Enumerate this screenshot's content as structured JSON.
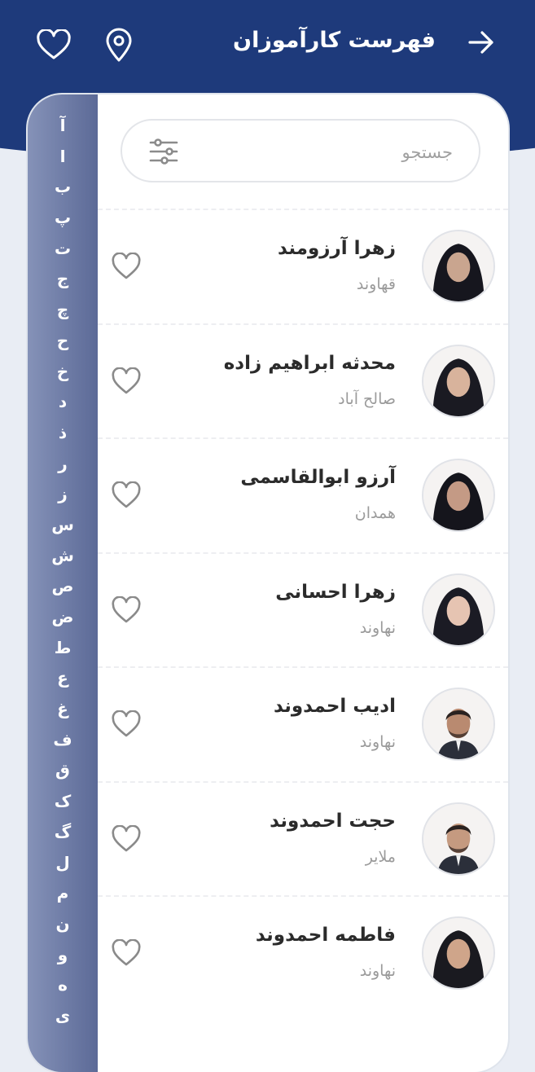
{
  "header": {
    "title": "فهرست کارآموزان",
    "back_icon": "arrow-right-icon",
    "location_icon": "map-pin-icon",
    "favorites_icon": "heart-outline-icon",
    "color": "#1e3a7b"
  },
  "search": {
    "placeholder": "جستجو",
    "filter_icon": "sliders-icon"
  },
  "alphabet": [
    "آ",
    "ا",
    "ب",
    "پ",
    "ت",
    "ج",
    "چ",
    "ح",
    "خ",
    "د",
    "ذ",
    "ر",
    "ز",
    "س",
    "ش",
    "ص",
    "ض",
    "ط",
    "ع",
    "غ",
    "ف",
    "ق",
    "ک",
    "گ",
    "ل",
    "م",
    "ن",
    "و",
    "ه",
    "ی"
  ],
  "trainees": [
    {
      "name": "زهرا آرزومند",
      "city": "قهاوند"
    },
    {
      "name": "محدثه ابراهیم زاده",
      "city": "صالح آباد"
    },
    {
      "name": "آرزو ابوالقاسمی",
      "city": "همدان"
    },
    {
      "name": "زهرا احسانی",
      "city": "نهاوند"
    },
    {
      "name": "ادیب احمدوند",
      "city": "نهاوند"
    },
    {
      "name": "حجت احمدوند",
      "city": "ملایر"
    },
    {
      "name": "فاطمه احمدوند",
      "city": "نهاوند"
    }
  ]
}
